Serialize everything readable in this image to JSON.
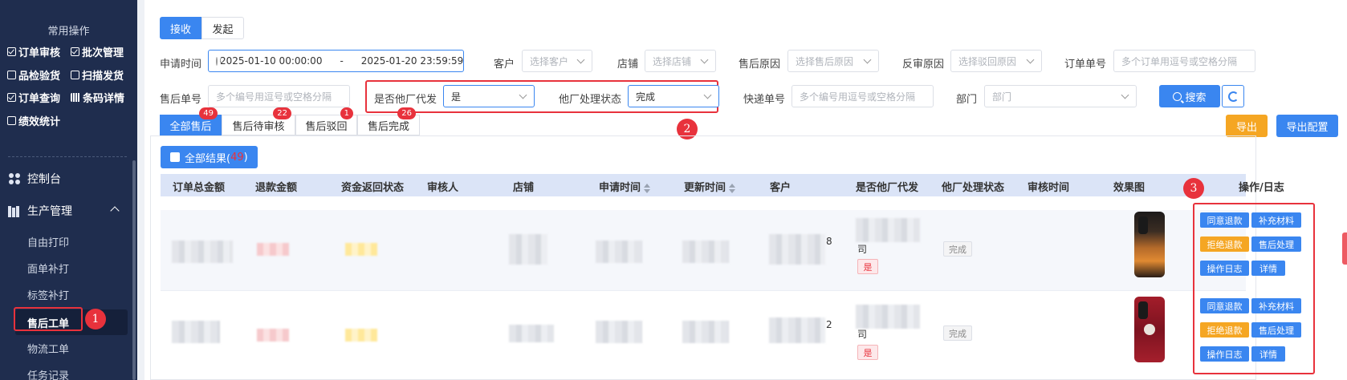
{
  "sidebar": {
    "quick_title": "常用操作",
    "quick_items": [
      {
        "label": "订单审核",
        "icon": "checkbox-icon"
      },
      {
        "label": "批次管理",
        "icon": "batch-icon"
      },
      {
        "label": "品检验货",
        "icon": "inspect-icon"
      },
      {
        "label": "扫描发货",
        "icon": "scan-icon"
      },
      {
        "label": "订单查询",
        "icon": "search-order-icon"
      },
      {
        "label": "条码详情",
        "icon": "barcode-icon"
      },
      {
        "label": "绩效统计",
        "icon": "stats-icon"
      }
    ],
    "menus": [
      {
        "label": "控制台",
        "icon": "dashboard-icon"
      },
      {
        "label": "生产管理",
        "icon": "production-icon",
        "expanded": true
      }
    ],
    "sub_items": [
      "自由打印",
      "面单补打",
      "标签补打",
      "售后工单",
      "物流工单",
      "任务记录"
    ],
    "active_sub": "售后工单"
  },
  "top_tabs": {
    "receive": "接收",
    "initiate": "发起",
    "active": "接收"
  },
  "filters": {
    "apply_time_label": "申请时间",
    "date_start": "2025-01-10 00:00:00",
    "date_sep": "-",
    "date_end": "2025-01-20 23:59:59",
    "customer_label": "客户",
    "customer_placeholder": "选择客户",
    "shop_label": "店铺",
    "shop_placeholder": "选择店铺",
    "reason_label": "售后原因",
    "reason_placeholder": "选择售后原因",
    "reject_label": "反审原因",
    "reject_placeholder": "选择驳回原因",
    "order_no_label": "订单单号",
    "order_no_placeholder": "多个订单用逗号或空格分隔",
    "aftersale_no_label": "售后单号",
    "aftersale_no_placeholder": "多个编号用逗号或空格分隔",
    "other_factory_label": "是否他厂代发",
    "other_factory_value": "是",
    "other_status_label": "他厂处理状态",
    "other_status_value": "完成",
    "express_label": "快递单号",
    "express_placeholder": "多个编号用逗号或空格分隔",
    "dept_label": "部门",
    "dept_placeholder": "部门",
    "search_label": "搜索"
  },
  "status_tabs": [
    {
      "label": "全部售后",
      "badge": "49",
      "active": true
    },
    {
      "label": "售后待审核",
      "badge": "22"
    },
    {
      "label": "售后驳回",
      "badge": "1"
    },
    {
      "label": "售后完成",
      "badge": "26"
    }
  ],
  "actions": {
    "export": "导出",
    "export_config": "导出配置"
  },
  "all_results": {
    "label": "全部结果(",
    "count": "49",
    "close": ")"
  },
  "table": {
    "headers": [
      "订单总金额",
      "退款金额",
      "资金返回状态",
      "审核人",
      "店铺",
      "申请时间",
      "更新时间",
      "客户",
      "是否他厂代发",
      "他厂处理状态",
      "审核时间",
      "效果图",
      "操作/日志"
    ],
    "rows": [
      {
        "customer_tail": "8",
        "factory_tail": "司",
        "other_factory": "是",
        "status": "完成"
      },
      {
        "customer_tail": "2",
        "factory_tail": "司",
        "other_factory": "是",
        "status": "完成"
      }
    ],
    "op_buttons": [
      {
        "label": "同意退款",
        "color": "#3a86f0"
      },
      {
        "label": "补充材料",
        "color": "#3a86f0"
      },
      {
        "label": "拒绝退款",
        "color": "#f5a623"
      },
      {
        "label": "售后处理",
        "color": "#3a86f0"
      },
      {
        "label": "操作日志",
        "color": "#3a86f0"
      },
      {
        "label": "详情",
        "color": "#3a86f0"
      }
    ]
  },
  "markers": [
    "1",
    "2",
    "3"
  ],
  "colors": {
    "primary": "#3a86f0",
    "warning": "#f5a623",
    "danger": "#e8323c",
    "sidebar": "#1f2d4e"
  }
}
